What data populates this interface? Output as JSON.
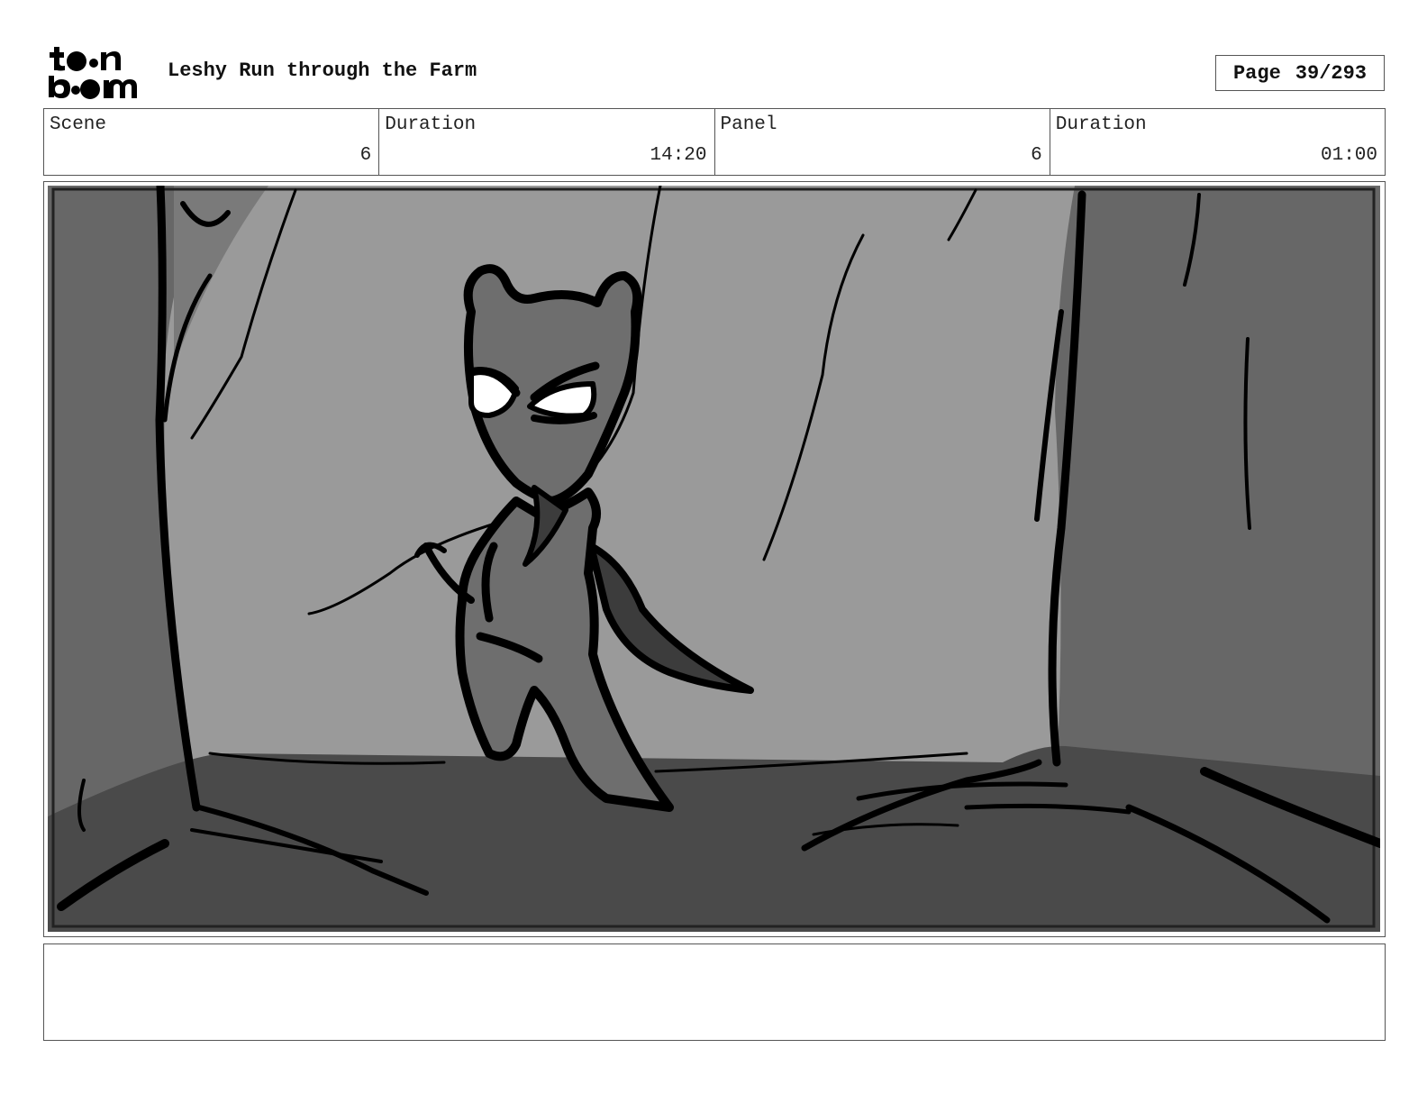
{
  "header": {
    "logo_line1": "to•n",
    "logo_line2": "b•om",
    "title": "Leshy Run through the Farm",
    "page_label": "Page",
    "page_value": "39/293"
  },
  "info": {
    "scene_label": "Scene",
    "scene_value": "6",
    "scene_duration_label": "Duration",
    "scene_duration_value": "14:20",
    "panel_label": "Panel",
    "panel_value": "6",
    "panel_duration_label": "Duration",
    "panel_duration_value": "01:00"
  },
  "panel": {
    "sky_color": "#9a9a9a",
    "tree_color": "#676767",
    "ground_color": "#4a4a4a",
    "character_color": "#6e6e6e",
    "eye_color": "#ffffff",
    "line_color": "#000000"
  },
  "notes": {
    "text": ""
  }
}
